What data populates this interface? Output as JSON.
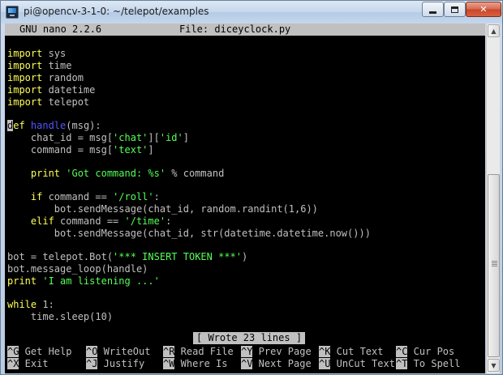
{
  "window": {
    "title": "pi@opencv-3-1-0: ~/telepot/examples",
    "minimize_icon": "minimize-icon",
    "maximize_icon": "maximize-icon",
    "close_icon": "close-icon",
    "close_glyph": "✕"
  },
  "nano": {
    "version": "GNU nano 2.2.6",
    "file_label": "File: diceyclock.py",
    "status_message": "[ Wrote 23 lines ]"
  },
  "code": {
    "l1_kw": "import",
    "l1_rest": " sys",
    "l2_kw": "import",
    "l2_rest": " time",
    "l3_kw": "import",
    "l3_rest": " random",
    "l4_kw": "import",
    "l4_rest": " datetime",
    "l5_kw": "import",
    "l5_rest": " telepot",
    "l7_cursor": "d",
    "l7_kw": "ef",
    "l7_fn": " handle",
    "l7_rest": "(msg):",
    "l8_a": "    chat_id = msg[",
    "l8_s1": "'chat'",
    "l8_b": "][",
    "l8_s2": "'id'",
    "l8_c": "]",
    "l9_a": "    command = msg[",
    "l9_s1": "'text'",
    "l9_b": "]",
    "l11_kw": "    print",
    "l11_s": " 'Got command: %s'",
    "l11_rest": " % command",
    "l13_kw": "    if",
    "l13_a": " command == ",
    "l13_s": "'/roll'",
    "l13_b": ":",
    "l14": "        bot.sendMessage(chat_id, random.randint(1,6))",
    "l15_kw": "    elif",
    "l15_a": " command == ",
    "l15_s": "'/time'",
    "l15_b": ":",
    "l16": "        bot.sendMessage(chat_id, str(datetime.datetime.now()))",
    "l18_a": "bot = telepot.Bot(",
    "l18_s": "'*** INSERT TOKEN ***'",
    "l18_b": ")",
    "l19": "bot.message_loop(handle)",
    "l20_kw": "print",
    "l20_s": " 'I am listening ...'",
    "l22_kw": "while",
    "l22_rest": " 1:",
    "l23": "    time.sleep(10)"
  },
  "shortcuts": {
    "row1": [
      {
        "key": "^G",
        "label": " Get Help"
      },
      {
        "key": "^O",
        "label": " WriteOut"
      },
      {
        "key": "^R",
        "label": " Read File"
      },
      {
        "key": "^Y",
        "label": " Prev Page"
      },
      {
        "key": "^K",
        "label": " Cut Text"
      },
      {
        "key": "^C",
        "label": " Cur Pos"
      }
    ],
    "row2": [
      {
        "key": "^X",
        "label": " Exit"
      },
      {
        "key": "^J",
        "label": " Justify"
      },
      {
        "key": "^W",
        "label": " Where Is"
      },
      {
        "key": "^V",
        "label": " Next Page"
      },
      {
        "key": "^U",
        "label": " UnCut Text"
      },
      {
        "key": "^T",
        "label": " To Spell"
      }
    ]
  },
  "scrollbar": {
    "up_arrow": "▲",
    "down_arrow": "▼"
  },
  "colors": {
    "keyword": "#ffff55",
    "string": "#55ff55",
    "function": "#5555ff",
    "header_bg": "#c0c0c0"
  }
}
